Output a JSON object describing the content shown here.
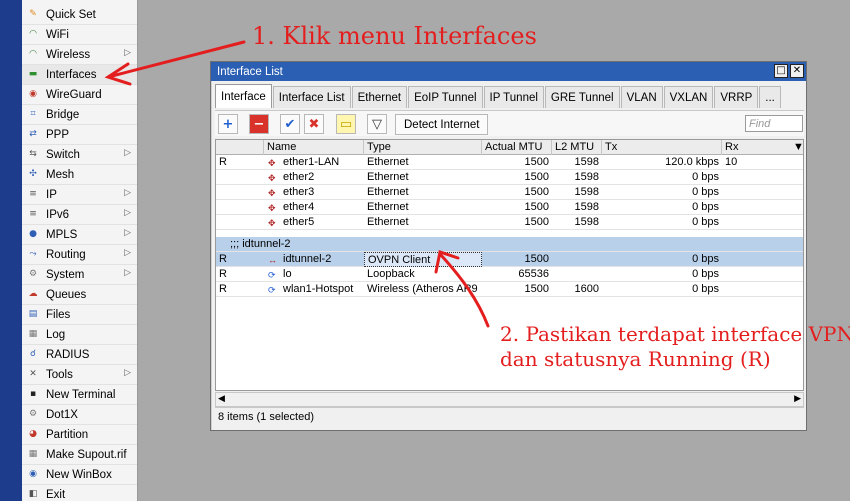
{
  "sidebar": {
    "items": [
      {
        "label": "Quick Set",
        "icon": "quickset-icon",
        "color": "#e08a1e",
        "sub": false
      },
      {
        "label": "WiFi",
        "icon": "wifi-icon",
        "color": "#3a7d3a",
        "sub": false
      },
      {
        "label": "Wireless",
        "icon": "wireless-icon",
        "color": "#3a7d3a",
        "sub": true
      },
      {
        "label": "Interfaces",
        "icon": "interfaces-icon",
        "color": "#2f8f2f",
        "sub": false
      },
      {
        "label": "WireGuard",
        "icon": "wireguard-icon",
        "color": "#c0392b",
        "sub": false
      },
      {
        "label": "Bridge",
        "icon": "bridge-icon",
        "color": "#3b6cc4",
        "sub": false
      },
      {
        "label": "PPP",
        "icon": "ppp-icon",
        "color": "#2f5fb5",
        "sub": false
      },
      {
        "label": "Switch",
        "icon": "switch-icon",
        "color": "#555555",
        "sub": true
      },
      {
        "label": "Mesh",
        "icon": "mesh-icon",
        "color": "#2f5fb5",
        "sub": false
      },
      {
        "label": "IP",
        "icon": "ip-icon",
        "color": "#555555",
        "sub": true
      },
      {
        "label": "IPv6",
        "icon": "ipv6-icon",
        "color": "#555555",
        "sub": true
      },
      {
        "label": "MPLS",
        "icon": "mpls-icon",
        "color": "#2f5fb5",
        "sub": true
      },
      {
        "label": "Routing",
        "icon": "routing-icon",
        "color": "#2f5fb5",
        "sub": true
      },
      {
        "label": "System",
        "icon": "system-icon",
        "color": "#777777",
        "sub": true
      },
      {
        "label": "Queues",
        "icon": "queues-icon",
        "color": "#c0392b",
        "sub": false
      },
      {
        "label": "Files",
        "icon": "files-icon",
        "color": "#2f5fb5",
        "sub": false
      },
      {
        "label": "Log",
        "icon": "log-icon",
        "color": "#777777",
        "sub": false
      },
      {
        "label": "RADIUS",
        "icon": "radius-icon",
        "color": "#2f5fb5",
        "sub": false
      },
      {
        "label": "Tools",
        "icon": "tools-icon",
        "color": "#555555",
        "sub": true
      },
      {
        "label": "New Terminal",
        "icon": "terminal-icon",
        "color": "#222222",
        "sub": false
      },
      {
        "label": "Dot1X",
        "icon": "dot1x-icon",
        "color": "#777777",
        "sub": false
      },
      {
        "label": "Partition",
        "icon": "partition-icon",
        "color": "#c0392b",
        "sub": false
      },
      {
        "label": "Make Supout.rif",
        "icon": "supout-icon",
        "color": "#777777",
        "sub": false
      },
      {
        "label": "New WinBox",
        "icon": "winbox-icon",
        "color": "#2f5fb5",
        "sub": false
      },
      {
        "label": "Exit",
        "icon": "exit-icon",
        "color": "#555555",
        "sub": false
      }
    ]
  },
  "window": {
    "title": "Interface List",
    "minimize": "□",
    "close": "✕",
    "tabs": [
      "Interface",
      "Interface List",
      "Ethernet",
      "EoIP Tunnel",
      "IP Tunnel",
      "GRE Tunnel",
      "VLAN",
      "VXLAN",
      "VRRP",
      "..."
    ],
    "active_tab": 0,
    "toolbar": {
      "add": "+",
      "remove": "−",
      "enable": "✔",
      "disable": "✖",
      "comment": "▭",
      "filter": "▽",
      "detect_label": "Detect Internet",
      "find_placeholder": "Find"
    },
    "columns": [
      "",
      "Name",
      "Type",
      "Actual MTU",
      "L2 MTU",
      "Tx",
      "Rx"
    ],
    "rows": [
      {
        "flag": "R",
        "name": "ether1-LAN",
        "type": "Ethernet",
        "mtu": "1500",
        "l2mtu": "1598",
        "tx": "120.0 kbps",
        "rx": "10"
      },
      {
        "flag": "",
        "name": "ether2",
        "type": "Ethernet",
        "mtu": "1500",
        "l2mtu": "1598",
        "tx": "0 bps",
        "rx": ""
      },
      {
        "flag": "",
        "name": "ether3",
        "type": "Ethernet",
        "mtu": "1500",
        "l2mtu": "1598",
        "tx": "0 bps",
        "rx": ""
      },
      {
        "flag": "",
        "name": "ether4",
        "type": "Ethernet",
        "mtu": "1500",
        "l2mtu": "1598",
        "tx": "0 bps",
        "rx": ""
      },
      {
        "flag": "",
        "name": "ether5",
        "type": "Ethernet",
        "mtu": "1500",
        "l2mtu": "1598",
        "tx": "0 bps",
        "rx": ""
      }
    ],
    "group_label": ";;; idtunnel-2",
    "rows2": [
      {
        "flag": "R",
        "name": "idtunnel-2",
        "type": "OVPN Client",
        "mtu": "1500",
        "l2mtu": "",
        "tx": "0 bps",
        "rx": ""
      },
      {
        "flag": "R",
        "name": "lo",
        "type": "Loopback",
        "mtu": "65536",
        "l2mtu": "",
        "tx": "0 bps",
        "rx": ""
      },
      {
        "flag": "R",
        "name": "wlan1-Hotspot",
        "type": "Wireless (Atheros AR9",
        "mtu": "1500",
        "l2mtu": "1600",
        "tx": "0 bps",
        "rx": ""
      }
    ],
    "status": "8 items (1 selected)"
  },
  "annotations": {
    "step1": "1. Klik menu Interfaces",
    "step2_line1": "2. Pastikan terdapat interface VPN",
    "step2_line2": "dan statusnya Running (R)",
    "color": "#e41e1e"
  }
}
